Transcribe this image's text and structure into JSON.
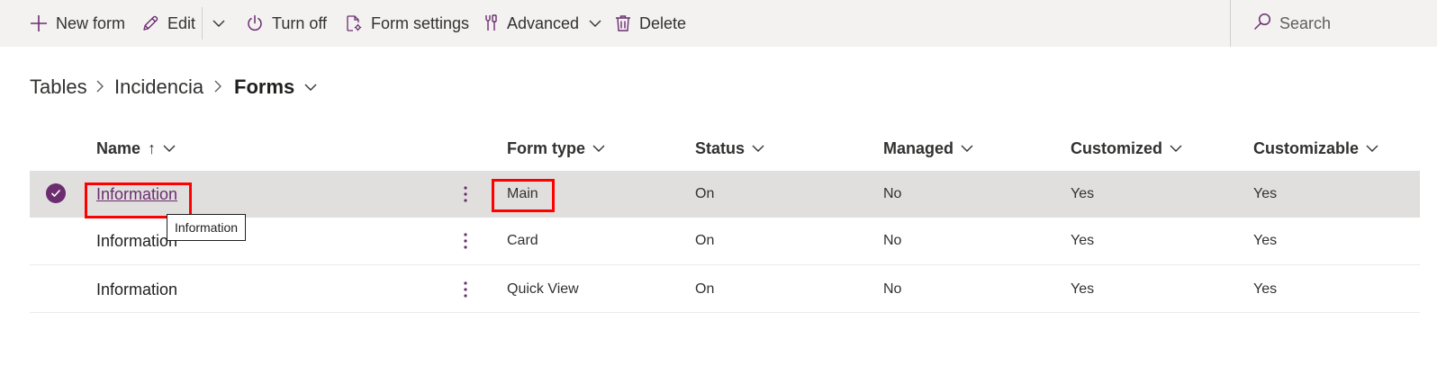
{
  "toolbar": {
    "new_form": "New form",
    "edit": "Edit",
    "turn_off": "Turn off",
    "form_settings": "Form settings",
    "advanced": "Advanced",
    "delete": "Delete",
    "search_placeholder": "Search"
  },
  "breadcrumb": {
    "tables": "Tables",
    "table": "Incidencia",
    "current": "Forms"
  },
  "table": {
    "headers": {
      "name": "Name",
      "form_type": "Form type",
      "status": "Status",
      "managed": "Managed",
      "customized": "Customized",
      "customizable": "Customizable"
    },
    "sort_indicator": "↑",
    "rows": [
      {
        "name": "Information",
        "form_type": "Main",
        "status": "On",
        "managed": "No",
        "customized": "Yes",
        "customizable": "Yes",
        "selected": true
      },
      {
        "name": "Information",
        "form_type": "Card",
        "status": "On",
        "managed": "No",
        "customized": "Yes",
        "customizable": "Yes",
        "selected": false
      },
      {
        "name": "Information",
        "form_type": "Quick View",
        "status": "On",
        "managed": "No",
        "customized": "Yes",
        "customizable": "Yes",
        "selected": false
      }
    ]
  },
  "tooltip": "Information",
  "colors": {
    "accent": "#6b2c70",
    "highlight_box": "#ff0000",
    "command_bar_bg": "#f3f2f1",
    "selected_row_bg": "#e1dfdd"
  },
  "icons": {
    "new_form": "plus-icon",
    "edit": "pencil-icon",
    "split": "chevron-down-icon",
    "turn_off": "power-icon",
    "form_settings": "document-gear-icon",
    "advanced": "wrench-screwdriver-icon",
    "delete": "trash-icon",
    "search": "search-icon",
    "breadcrumb_separator": "chevron-right-icon",
    "row_selected": "checkmark-circle-icon",
    "row_more": "more-vertical-icon"
  }
}
